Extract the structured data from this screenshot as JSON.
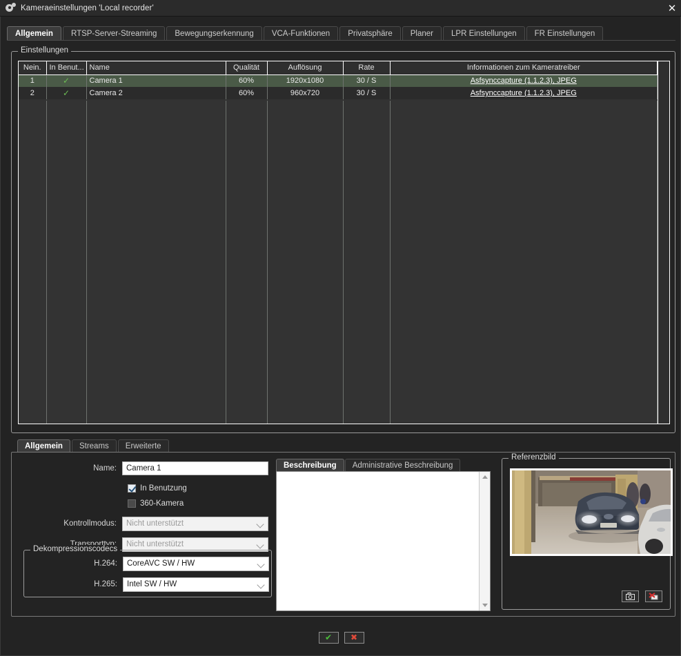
{
  "window": {
    "title": "Kameraeinstellungen 'Local recorder'",
    "icon": "gear-icon",
    "close_label": "✕"
  },
  "tabs": [
    {
      "label": "Allgemein",
      "active": true
    },
    {
      "label": "RTSP-Server-Streaming",
      "active": false
    },
    {
      "label": "Bewegungserkennung",
      "active": false
    },
    {
      "label": "VCA-Funktionen",
      "active": false
    },
    {
      "label": "Privatsphäre",
      "active": false
    },
    {
      "label": "Planer",
      "active": false
    },
    {
      "label": "LPR Einstellungen",
      "active": false
    },
    {
      "label": "FR Einstellungen",
      "active": false
    }
  ],
  "settings_group": {
    "label": "Einstellungen",
    "table": {
      "columns": [
        "Nein.",
        "In Benut...",
        "Name",
        "Qualität",
        "Auflösung",
        "Rate",
        "Informationen zum Kameratreiber"
      ],
      "rows": [
        {
          "no": "1",
          "in_use": "✓",
          "name": "Camera 1",
          "quality": "60%",
          "resolution": "1920x1080",
          "rate": "30 / S",
          "driver": "Asfsynccapture (1.1.2.3), JPEG",
          "selected": true
        },
        {
          "no": "2",
          "in_use": "✓",
          "name": "Camera 2",
          "quality": "60%",
          "resolution": "960x720",
          "rate": "30 / S",
          "driver": "Asfsynccapture (1.1.2.3), JPEG",
          "selected": false
        }
      ]
    }
  },
  "lower_tabs": [
    {
      "label": "Allgemein",
      "active": true
    },
    {
      "label": "Streams",
      "active": false
    },
    {
      "label": "Erweiterte",
      "active": false
    }
  ],
  "form": {
    "name_label": "Name:",
    "name_value": "Camera 1",
    "in_use_label": "In Benutzung",
    "in_use_checked": true,
    "camera360_label": "360-Kamera",
    "camera360_checked": false,
    "control_mode_label": "Kontrollmodus:",
    "control_mode_value": "Nicht unterstützt",
    "transport_label": "Transporttyp:",
    "transport_value": "Nicht unterstützt"
  },
  "codecs": {
    "group_label": "Dekompressionscodecs",
    "h264_label": "H.264:",
    "h264_value": "CoreAVC SW / HW",
    "h265_label": "H.265:",
    "h265_value": "Intel SW / HW"
  },
  "description": {
    "tabs": [
      {
        "label": "Beschreibung",
        "active": true
      },
      {
        "label": "Administrative Beschreibung",
        "active": false
      }
    ],
    "value": ""
  },
  "reference": {
    "group_label": "Referenzbild",
    "snapshot_icon": "camera-icon",
    "delete_icon": "delete-image-icon"
  },
  "footer": {
    "ok_label": "✔",
    "cancel_label": "✖"
  },
  "colors": {
    "accent_selected_row": "#4a5a47",
    "check_green": "#6dbd55",
    "ok_green": "#4bbf3a",
    "cancel_red": "#e04a3a",
    "window_bg": "#232323",
    "titlebar_bg": "#2b2b2b"
  }
}
